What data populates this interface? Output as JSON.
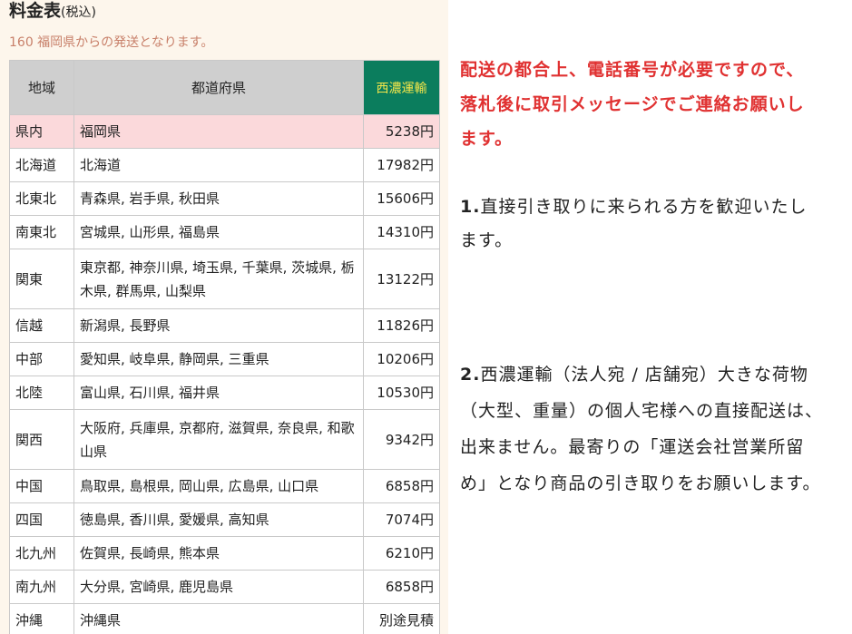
{
  "header": {
    "title": "料金表",
    "title_suffix": "(税込)",
    "subtitle": "160 福岡県からの発送となります。"
  },
  "table": {
    "headers": {
      "region": "地域",
      "prefectures": "都道府県",
      "carrier": "西濃運輸"
    },
    "rows": [
      {
        "region": "県内",
        "prefectures": "福岡県",
        "price": "5238円",
        "highlight": true
      },
      {
        "region": "北海道",
        "prefectures": "北海道",
        "price": "17982円"
      },
      {
        "region": "北東北",
        "prefectures": "青森県, 岩手県, 秋田県",
        "price": "15606円"
      },
      {
        "region": "南東北",
        "prefectures": "宮城県, 山形県, 福島県",
        "price": "14310円"
      },
      {
        "region": "関東",
        "prefectures": "東京都, 神奈川県, 埼玉県, 千葉県, 茨城県, 栃木県, 群馬県, 山梨県",
        "price": "13122円",
        "tall": true
      },
      {
        "region": "信越",
        "prefectures": "新潟県, 長野県",
        "price": "11826円"
      },
      {
        "region": "中部",
        "prefectures": "愛知県, 岐阜県, 静岡県, 三重県",
        "price": "10206円"
      },
      {
        "region": "北陸",
        "prefectures": "富山県, 石川県, 福井県",
        "price": "10530円"
      },
      {
        "region": "関西",
        "prefectures": "大阪府, 兵庫県, 京都府, 滋賀県, 奈良県, 和歌山県",
        "price": "9342円",
        "tall": true
      },
      {
        "region": "中国",
        "prefectures": "鳥取県, 島根県, 岡山県, 広島県, 山口県",
        "price": "6858円"
      },
      {
        "region": "四国",
        "prefectures": "徳島県, 香川県, 愛媛県, 高知県",
        "price": "7074円"
      },
      {
        "region": "北九州",
        "prefectures": "佐賀県, 長崎県, 熊本県",
        "price": "6210円"
      },
      {
        "region": "南九州",
        "prefectures": "大分県, 宮崎県, 鹿児島県",
        "price": "6858円"
      },
      {
        "region": "沖縄",
        "prefectures": "沖縄県",
        "price": "別途見積"
      }
    ]
  },
  "notice": {
    "text": "配送の都合上、電話番号が必要ですので、落札後に取引メッセージでご連絡お願いします。"
  },
  "notes": [
    {
      "num": "1.",
      "text": "直接引き取りに来られる方を歓迎いたします。"
    },
    {
      "num": "2.",
      "text": "西濃運輸（法人宛 / 店舗宛）大きな荷物（大型、重量）の個人宅様への直接配送は、出来ません。最寄りの「運送会社営業所留め」となり商品の引き取りをお願いします。"
    }
  ],
  "colors": {
    "carrier_header_bg": "#0b7d5d",
    "carrier_header_text": "#f4e64a",
    "highlight_row": "#fbd9db",
    "notice_text": "#e03131",
    "subtitle_text": "#c8806a",
    "panel_bg": "#fdf6ec"
  }
}
